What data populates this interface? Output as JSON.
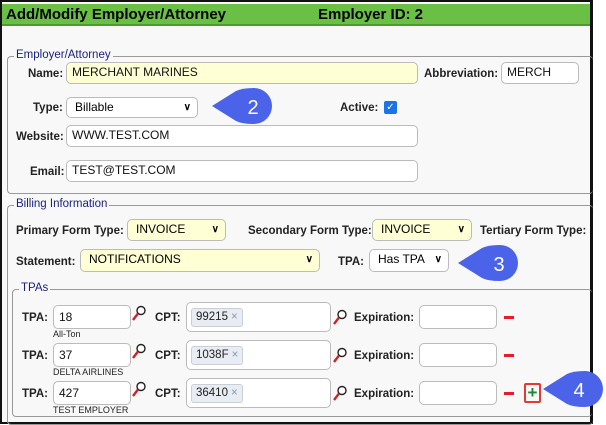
{
  "header": {
    "title": "Add/Modify Employer/Attorney",
    "employer_id": "Employer ID: 2"
  },
  "employer": {
    "legend": "Employer/Attorney",
    "name_label": "Name:",
    "name_value": "MERCHANT MARINES",
    "abbr_label": "Abbreviation:",
    "abbr_value": "MERCH",
    "type_label": "Type:",
    "type_value": "Billable",
    "active_label": "Active:",
    "active_checked": true,
    "website_label": "Website:",
    "website_value": "WWW.TEST.COM",
    "email_label": "Email:",
    "email_value": "TEST@TEST.COM"
  },
  "billing": {
    "legend": "Billing Information",
    "primary_label": "Primary Form Type:",
    "primary_value": "INVOICE",
    "secondary_label": "Secondary Form Type:",
    "secondary_value": "INVOICE",
    "tertiary_label": "Tertiary Form Type:",
    "statement_label": "Statement:",
    "statement_value": "NOTIFICATIONS",
    "tpa_label": "TPA:",
    "tpa_value": "Has TPA"
  },
  "tpas": {
    "legend": "TPAs",
    "tpa_label": "TPA:",
    "cpt_label": "CPT:",
    "exp_label": "Expiration:",
    "rows": [
      {
        "tpa": "18",
        "name": "All-Ton",
        "cpt": "99215",
        "expiration": ""
      },
      {
        "tpa": "37",
        "name": "DELTA AIRLINES",
        "cpt": "1038F",
        "expiration": ""
      },
      {
        "tpa": "427",
        "name": "TEST EMPLOYER",
        "cpt": "36410",
        "expiration": ""
      }
    ]
  },
  "callouts": [
    "2",
    "3",
    "4"
  ],
  "colors": {
    "header": "#6abf45",
    "callout": "#4a63e8",
    "remove": "#e81b2b",
    "add": "#1a8a2a",
    "highlight": "#e53935"
  }
}
